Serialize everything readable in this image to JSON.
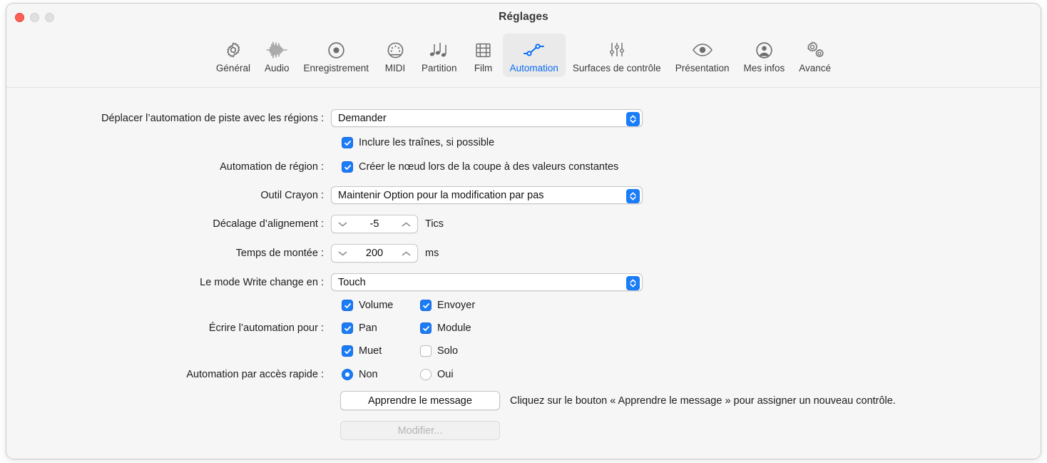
{
  "window": {
    "title": "Réglages",
    "traffic_lights": [
      "close",
      "minimize",
      "maximize"
    ]
  },
  "toolbar": {
    "items": [
      {
        "label": "Général",
        "icon": "gear-icon",
        "selected": false
      },
      {
        "label": "Audio",
        "icon": "waveform-icon",
        "selected": false
      },
      {
        "label": "Enregistrement",
        "icon": "record-icon",
        "selected": false
      },
      {
        "label": "MIDI",
        "icon": "midi-port-icon",
        "selected": false
      },
      {
        "label": "Partition",
        "icon": "music-notes-icon",
        "selected": false
      },
      {
        "label": "Film",
        "icon": "film-strip-icon",
        "selected": false
      },
      {
        "label": "Automation",
        "icon": "automation-node-icon",
        "selected": true
      },
      {
        "label": "Surfaces de contrôle",
        "icon": "sliders-icon",
        "selected": false
      },
      {
        "label": "Présentation",
        "icon": "eye-icon",
        "selected": false
      },
      {
        "label": "Mes infos",
        "icon": "person-icon",
        "selected": false
      },
      {
        "label": "Avancé",
        "icon": "gears-icon",
        "selected": false
      }
    ],
    "selected_color": "#0a6cf5"
  },
  "form": {
    "move_track_automation": {
      "label": "Déplacer l’automation de piste avec les régions :",
      "value": "Demander"
    },
    "include_trails": {
      "label": "Inclure les traînes, si possible",
      "checked": true
    },
    "region_automation": {
      "label": "Automation de région :",
      "checkbox_label": "Créer le nœud lors de la coupe à des valeurs constantes",
      "checked": true
    },
    "pencil_tool": {
      "label": "Outil Crayon :",
      "value": "Maintenir Option pour la modification par pas"
    },
    "snap_offset": {
      "label": "Décalage d’alignement :",
      "value": "-5",
      "unit": "Tics"
    },
    "ramp_time": {
      "label": "Temps de montée :",
      "value": "200",
      "unit": "ms"
    },
    "write_mode_changes_to": {
      "label": "Le mode Write change en :",
      "value": "Touch"
    },
    "write_automation_for": {
      "label": "Écrire l’automation pour :",
      "options": [
        {
          "label": "Volume",
          "checked": true
        },
        {
          "label": "Envoyer",
          "checked": true
        },
        {
          "label": "Pan",
          "checked": true
        },
        {
          "label": "Module",
          "checked": true
        },
        {
          "label": "Muet",
          "checked": true
        },
        {
          "label": "Solo",
          "checked": false
        }
      ]
    },
    "quick_access_automation": {
      "label": "Automation par accès rapide :",
      "options": [
        {
          "label": "Non",
          "selected": true
        },
        {
          "label": "Oui",
          "selected": false
        }
      ]
    },
    "learn_message_button": "Apprendre le message",
    "learn_message_help": "Cliquez sur le bouton « Apprendre le message » pour assigner un nouveau contrôle.",
    "edit_button": {
      "label": "Modifier...",
      "disabled": true
    }
  }
}
